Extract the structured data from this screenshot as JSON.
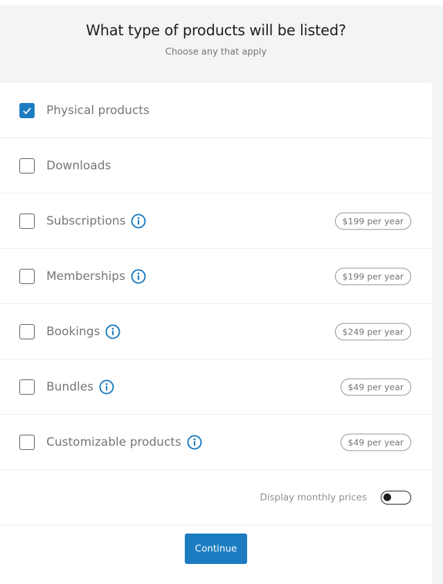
{
  "header": {
    "title": "What type of products will be listed?",
    "subtitle": "Choose any that apply"
  },
  "colors": {
    "accent": "#1b7cc1",
    "page_background": "#f3f4f4",
    "card_background": "#ffffff"
  },
  "products": [
    {
      "label": "Physical products",
      "checked": true,
      "info_icon": false,
      "price": null
    },
    {
      "label": "Downloads",
      "checked": false,
      "info_icon": false,
      "price": null
    },
    {
      "label": "Subscriptions",
      "checked": false,
      "info_icon": true,
      "price": "$199 per year"
    },
    {
      "label": "Memberships",
      "checked": false,
      "info_icon": true,
      "price": "$199 per year"
    },
    {
      "label": "Bookings",
      "checked": false,
      "info_icon": true,
      "price": "$249 per year"
    },
    {
      "label": "Bundles",
      "checked": false,
      "info_icon": true,
      "price": "$49 per year"
    },
    {
      "label": "Customizable products",
      "checked": false,
      "info_icon": true,
      "price": "$49 per year"
    }
  ],
  "monthly_toggle": {
    "label": "Display monthly prices",
    "on": false
  },
  "footer": {
    "continue_label": "Continue"
  }
}
